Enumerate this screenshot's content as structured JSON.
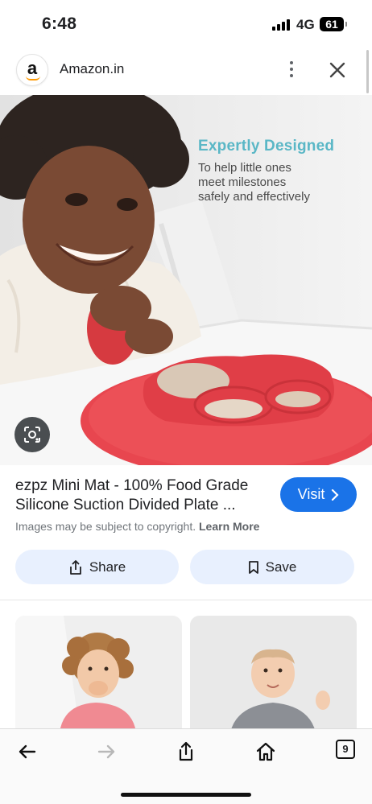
{
  "status_bar": {
    "time": "6:48",
    "network": "4G",
    "battery": "61"
  },
  "source": {
    "logo_letter": "a",
    "name": "Amazon.in"
  },
  "hero": {
    "heading": "Expertly Designed",
    "subtext": "To help little ones\nmeet milestones\nsafely and effectively"
  },
  "product": {
    "title": "ezpz Mini Mat - 100% Food Grade Silicone Suction Divided Plate ...",
    "visit_label": "Visit",
    "copyright_text": "Images may be subject to copyright.",
    "learn_more": "Learn More"
  },
  "actions": {
    "share_label": "Share",
    "save_label": "Save"
  },
  "toolbar": {
    "tabs_count": "9"
  },
  "colors": {
    "accent": "#1a73e8",
    "action_bg": "#e8f0fe",
    "heading_teal": "#5ab7c6",
    "mat_red": "#e8464f"
  },
  "icons": [
    "back-icon",
    "forward-icon",
    "share-icon",
    "home-icon",
    "tabs-icon",
    "close-icon",
    "more-icon",
    "lens-icon",
    "bookmark-icon"
  ]
}
